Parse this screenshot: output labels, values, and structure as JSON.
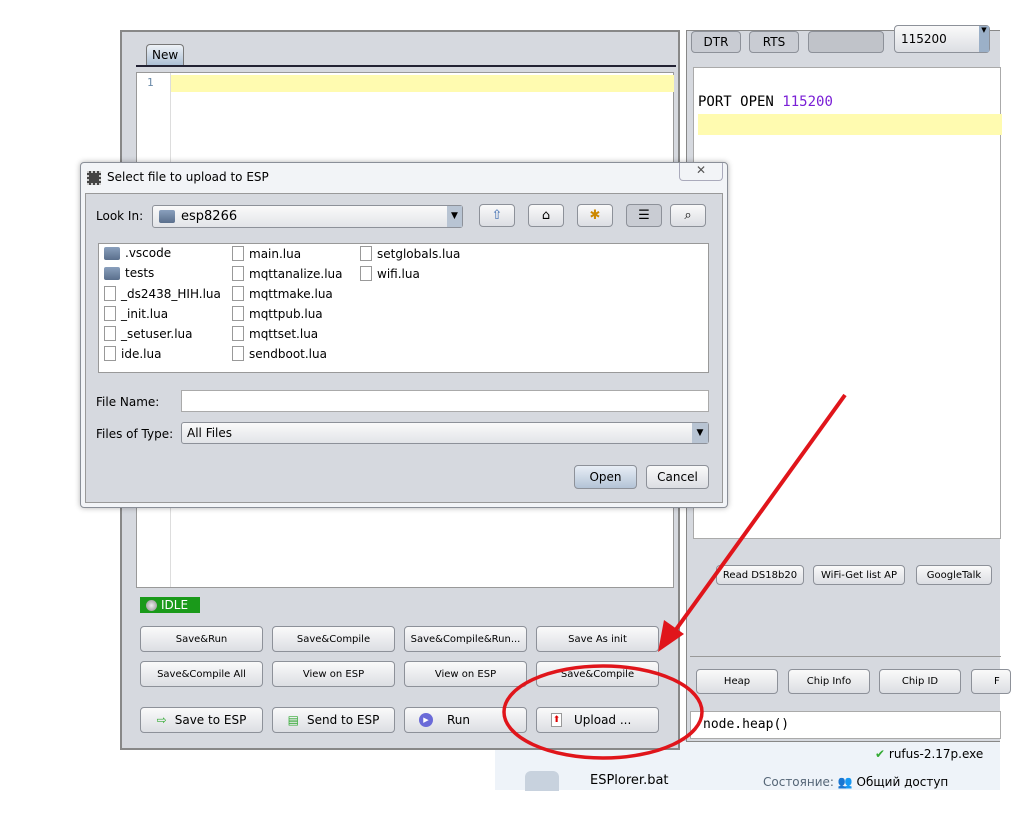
{
  "editor": {
    "tab": "New",
    "line_number": "1",
    "status": "IDLE",
    "buttons_row1": [
      "Save&Run",
      "Save&Compile",
      "Save&Compile&Run...",
      "Save As init"
    ],
    "buttons_row2": [
      "Save&Compile All",
      "View on ESP",
      "View on ESP",
      "Save&Compile"
    ],
    "save_to_esp": "Save to ESP",
    "send_to_esp": "Send to ESP",
    "run": "Run",
    "upload": "Upload ..."
  },
  "terminal": {
    "dtr": "DTR",
    "rts": "RTS",
    "baud": "115200",
    "port_text": "PORT OPEN",
    "port_baud": "115200",
    "snippets": [
      "Read DS18b20",
      "WiFi-Get list AP",
      "GoogleTalk"
    ],
    "commands": [
      "Heap",
      "Chip Info",
      "Chip ID",
      "F"
    ],
    "command_input": "node.heap()"
  },
  "dialog": {
    "title": "Select file to upload to ESP",
    "look_in_label": "Look In:",
    "look_in_value": "esp8266",
    "files": [
      {
        "name": ".vscode",
        "type": "folder"
      },
      {
        "name": "tests",
        "type": "folder"
      },
      {
        "name": "_ds2438_HIH.lua",
        "type": "file"
      },
      {
        "name": "_init.lua",
        "type": "file"
      },
      {
        "name": "_setuser.lua",
        "type": "file"
      },
      {
        "name": "ide.lua",
        "type": "file"
      },
      {
        "name": "main.lua",
        "type": "file"
      },
      {
        "name": "mqttanalize.lua",
        "type": "file"
      },
      {
        "name": "mqttmake.lua",
        "type": "file"
      },
      {
        "name": "mqttpub.lua",
        "type": "file"
      },
      {
        "name": "mqttset.lua",
        "type": "file"
      },
      {
        "name": "sendboot.lua",
        "type": "file"
      },
      {
        "name": "setglobals.lua",
        "type": "file"
      },
      {
        "name": "wifi.lua",
        "type": "file"
      }
    ],
    "file_name_label": "File Name:",
    "file_name_value": "",
    "files_of_type_label": "Files of Type:",
    "files_of_type_value": "All Files",
    "open": "Open",
    "cancel": "Cancel"
  },
  "explorer": {
    "file": "ESPlorer.bat",
    "other_file": "rufus-2.17p.exe",
    "status_label": "Состояние:",
    "status_value": "Общий доступ"
  },
  "colors": {
    "annotation": "#e0151b",
    "idle_badge": "#1a9a1a",
    "highlight_line": "#fffbb0",
    "baud_text": "#7a1fd6"
  }
}
